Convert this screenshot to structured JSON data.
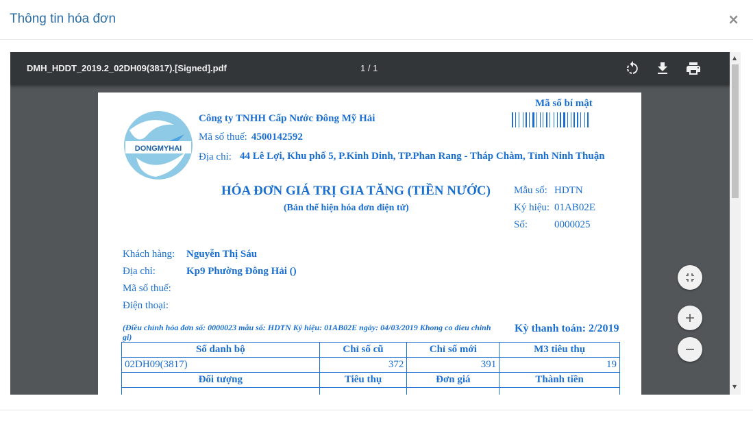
{
  "modal": {
    "title": "Thông tin hóa đơn",
    "close_glyph": "×"
  },
  "toolbar": {
    "file_name": "DMH_HDDT_2019.2_02DH09(3817).[Signed].pdf",
    "page_counter": "1 / 1",
    "icons": [
      "rotate-icon",
      "download-icon",
      "print-icon"
    ]
  },
  "invoice": {
    "logo_text": "DONGMYHAI",
    "company_name": "Công ty TNHH Cấp Nước Đông Mỹ Hải",
    "tax_label": "Mã số thuế:",
    "tax_code": "4500142592",
    "address_label": "Địa chỉ:",
    "address": "44 Lê Lợi, Khu phố 5, P.Kinh Dinh, TP.Phan Rang - Tháp Chàm, Tỉnh Ninh Thuận",
    "secret_label": "Mã số bí mật",
    "title": "HÓA ĐƠN GIÁ TRỊ GIA TĂNG (TIỀN NƯỚC)",
    "subtitle": "(Bản thể hiện hóa đơn điện tử)",
    "form_label": "Mẫu số:",
    "form_value": "HDTN",
    "symbol_label": "Ký hiệu:",
    "symbol_value": "01AB02E",
    "number_label": "Số:",
    "number_value": "0000025",
    "customer_label": "Khách hàng:",
    "customer_value": "Nguyễn Thị Sáu",
    "cust_address_label": "Địa chỉ:",
    "cust_address_value": "Kp9 Phường Đông Hải ()",
    "cust_tax_label": "Mã số thuế:",
    "phone_label": "Điện thoại:",
    "adjust_note": "(Điều chỉnh hóa đơn số: 0000023 mẫu số: HDTN Ký hiệu: 01AB02E ngày: 04/03/2019 Khong co dieu chinh gi)",
    "period": "Kỳ thanh toán: 2/2019",
    "table": {
      "h1": [
        "Số danh bộ",
        "Chỉ số cũ",
        "Chỉ số mới",
        "M3 tiêu thụ"
      ],
      "r1": [
        "02DH09(3817)",
        "372",
        "391",
        "19"
      ],
      "h2": [
        "Đối tượng",
        "Tiêu thụ",
        "Đơn giá",
        "Thành tiền"
      ]
    }
  },
  "colors": {
    "accent": "#2b6ca3",
    "invoice_blue": "#1a6fd0",
    "viewer_bg": "#525659",
    "toolbar_bg": "#323639"
  }
}
